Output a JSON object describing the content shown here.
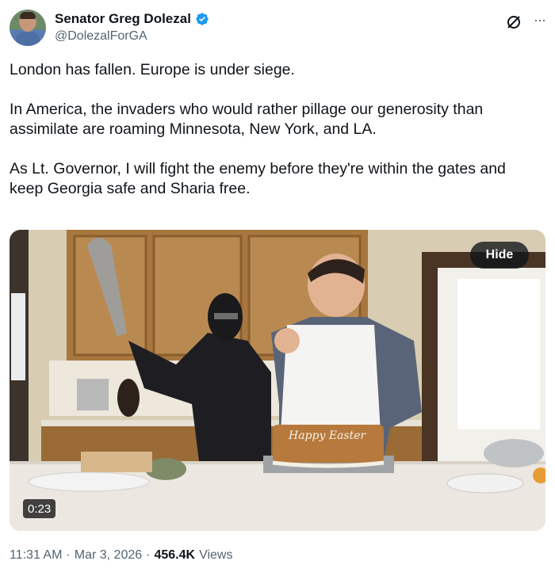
{
  "author": {
    "display_name": "Senator Greg Dolezal",
    "handle": "@DolezalForGA",
    "verified_color": "#1d9bf0"
  },
  "tweet": {
    "paragraphs": [
      "London has fallen. Europe is under siege.",
      "In America, the invaders who would rather pillage our generosity than assimilate are roaming Minnesota, New York, and LA.",
      "As Lt. Governor, I will fight the enemy before they're within the gates and keep Georgia safe and Sharia free."
    ]
  },
  "media": {
    "hide_label": "Hide",
    "duration": "0:23",
    "cake_text": "Happy Easter"
  },
  "meta": {
    "time": "11:31 AM",
    "separator": "·",
    "date": "Mar 3, 2026",
    "views_count": "456.4K",
    "views_label": "Views"
  },
  "icons": {
    "verified": "verified-badge-icon",
    "grok": "grok-icon",
    "more": "more-icon"
  }
}
